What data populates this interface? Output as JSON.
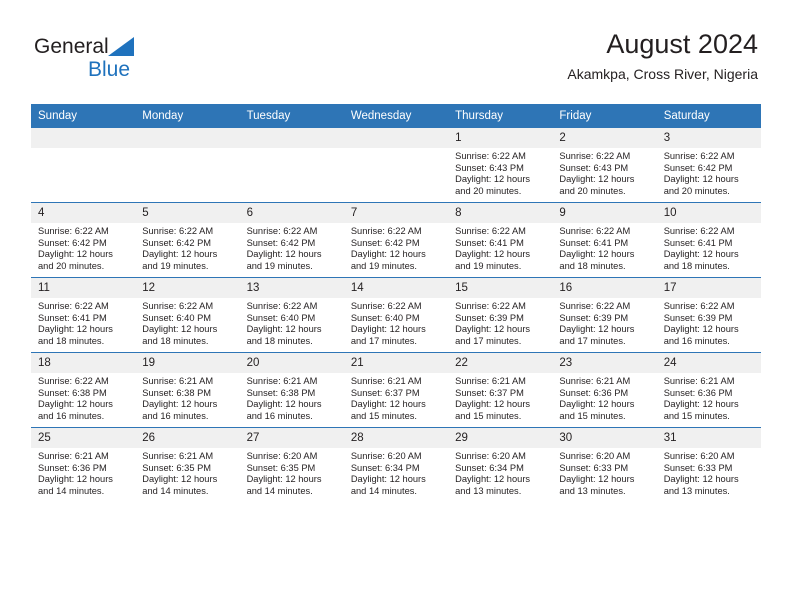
{
  "brand": {
    "name_part1": "General",
    "name_part2": "Blue",
    "accent_color": "#1f72bd",
    "triangle_icon": "brand-triangle-icon"
  },
  "header": {
    "title": "August 2024",
    "location": "Akamkpa, Cross River, Nigeria"
  },
  "calendar": {
    "header_color": "#2e75b6",
    "daynum_band_color": "#f0f0f0",
    "weekday_headers": [
      "Sunday",
      "Monday",
      "Tuesday",
      "Wednesday",
      "Thursday",
      "Friday",
      "Saturday"
    ],
    "weeks": [
      [
        {
          "day": "",
          "sunrise": "",
          "sunset": "",
          "daylight_line1": "",
          "daylight_line2": ""
        },
        {
          "day": "",
          "sunrise": "",
          "sunset": "",
          "daylight_line1": "",
          "daylight_line2": ""
        },
        {
          "day": "",
          "sunrise": "",
          "sunset": "",
          "daylight_line1": "",
          "daylight_line2": ""
        },
        {
          "day": "",
          "sunrise": "",
          "sunset": "",
          "daylight_line1": "",
          "daylight_line2": ""
        },
        {
          "day": "1",
          "sunrise": "Sunrise: 6:22 AM",
          "sunset": "Sunset: 6:43 PM",
          "daylight_line1": "Daylight: 12 hours",
          "daylight_line2": "and 20 minutes."
        },
        {
          "day": "2",
          "sunrise": "Sunrise: 6:22 AM",
          "sunset": "Sunset: 6:43 PM",
          "daylight_line1": "Daylight: 12 hours",
          "daylight_line2": "and 20 minutes."
        },
        {
          "day": "3",
          "sunrise": "Sunrise: 6:22 AM",
          "sunset": "Sunset: 6:42 PM",
          "daylight_line1": "Daylight: 12 hours",
          "daylight_line2": "and 20 minutes."
        }
      ],
      [
        {
          "day": "4",
          "sunrise": "Sunrise: 6:22 AM",
          "sunset": "Sunset: 6:42 PM",
          "daylight_line1": "Daylight: 12 hours",
          "daylight_line2": "and 20 minutes."
        },
        {
          "day": "5",
          "sunrise": "Sunrise: 6:22 AM",
          "sunset": "Sunset: 6:42 PM",
          "daylight_line1": "Daylight: 12 hours",
          "daylight_line2": "and 19 minutes."
        },
        {
          "day": "6",
          "sunrise": "Sunrise: 6:22 AM",
          "sunset": "Sunset: 6:42 PM",
          "daylight_line1": "Daylight: 12 hours",
          "daylight_line2": "and 19 minutes."
        },
        {
          "day": "7",
          "sunrise": "Sunrise: 6:22 AM",
          "sunset": "Sunset: 6:42 PM",
          "daylight_line1": "Daylight: 12 hours",
          "daylight_line2": "and 19 minutes."
        },
        {
          "day": "8",
          "sunrise": "Sunrise: 6:22 AM",
          "sunset": "Sunset: 6:41 PM",
          "daylight_line1": "Daylight: 12 hours",
          "daylight_line2": "and 19 minutes."
        },
        {
          "day": "9",
          "sunrise": "Sunrise: 6:22 AM",
          "sunset": "Sunset: 6:41 PM",
          "daylight_line1": "Daylight: 12 hours",
          "daylight_line2": "and 18 minutes."
        },
        {
          "day": "10",
          "sunrise": "Sunrise: 6:22 AM",
          "sunset": "Sunset: 6:41 PM",
          "daylight_line1": "Daylight: 12 hours",
          "daylight_line2": "and 18 minutes."
        }
      ],
      [
        {
          "day": "11",
          "sunrise": "Sunrise: 6:22 AM",
          "sunset": "Sunset: 6:41 PM",
          "daylight_line1": "Daylight: 12 hours",
          "daylight_line2": "and 18 minutes."
        },
        {
          "day": "12",
          "sunrise": "Sunrise: 6:22 AM",
          "sunset": "Sunset: 6:40 PM",
          "daylight_line1": "Daylight: 12 hours",
          "daylight_line2": "and 18 minutes."
        },
        {
          "day": "13",
          "sunrise": "Sunrise: 6:22 AM",
          "sunset": "Sunset: 6:40 PM",
          "daylight_line1": "Daylight: 12 hours",
          "daylight_line2": "and 18 minutes."
        },
        {
          "day": "14",
          "sunrise": "Sunrise: 6:22 AM",
          "sunset": "Sunset: 6:40 PM",
          "daylight_line1": "Daylight: 12 hours",
          "daylight_line2": "and 17 minutes."
        },
        {
          "day": "15",
          "sunrise": "Sunrise: 6:22 AM",
          "sunset": "Sunset: 6:39 PM",
          "daylight_line1": "Daylight: 12 hours",
          "daylight_line2": "and 17 minutes."
        },
        {
          "day": "16",
          "sunrise": "Sunrise: 6:22 AM",
          "sunset": "Sunset: 6:39 PM",
          "daylight_line1": "Daylight: 12 hours",
          "daylight_line2": "and 17 minutes."
        },
        {
          "day": "17",
          "sunrise": "Sunrise: 6:22 AM",
          "sunset": "Sunset: 6:39 PM",
          "daylight_line1": "Daylight: 12 hours",
          "daylight_line2": "and 16 minutes."
        }
      ],
      [
        {
          "day": "18",
          "sunrise": "Sunrise: 6:22 AM",
          "sunset": "Sunset: 6:38 PM",
          "daylight_line1": "Daylight: 12 hours",
          "daylight_line2": "and 16 minutes."
        },
        {
          "day": "19",
          "sunrise": "Sunrise: 6:21 AM",
          "sunset": "Sunset: 6:38 PM",
          "daylight_line1": "Daylight: 12 hours",
          "daylight_line2": "and 16 minutes."
        },
        {
          "day": "20",
          "sunrise": "Sunrise: 6:21 AM",
          "sunset": "Sunset: 6:38 PM",
          "daylight_line1": "Daylight: 12 hours",
          "daylight_line2": "and 16 minutes."
        },
        {
          "day": "21",
          "sunrise": "Sunrise: 6:21 AM",
          "sunset": "Sunset: 6:37 PM",
          "daylight_line1": "Daylight: 12 hours",
          "daylight_line2": "and 15 minutes."
        },
        {
          "day": "22",
          "sunrise": "Sunrise: 6:21 AM",
          "sunset": "Sunset: 6:37 PM",
          "daylight_line1": "Daylight: 12 hours",
          "daylight_line2": "and 15 minutes."
        },
        {
          "day": "23",
          "sunrise": "Sunrise: 6:21 AM",
          "sunset": "Sunset: 6:36 PM",
          "daylight_line1": "Daylight: 12 hours",
          "daylight_line2": "and 15 minutes."
        },
        {
          "day": "24",
          "sunrise": "Sunrise: 6:21 AM",
          "sunset": "Sunset: 6:36 PM",
          "daylight_line1": "Daylight: 12 hours",
          "daylight_line2": "and 15 minutes."
        }
      ],
      [
        {
          "day": "25",
          "sunrise": "Sunrise: 6:21 AM",
          "sunset": "Sunset: 6:36 PM",
          "daylight_line1": "Daylight: 12 hours",
          "daylight_line2": "and 14 minutes."
        },
        {
          "day": "26",
          "sunrise": "Sunrise: 6:21 AM",
          "sunset": "Sunset: 6:35 PM",
          "daylight_line1": "Daylight: 12 hours",
          "daylight_line2": "and 14 minutes."
        },
        {
          "day": "27",
          "sunrise": "Sunrise: 6:20 AM",
          "sunset": "Sunset: 6:35 PM",
          "daylight_line1": "Daylight: 12 hours",
          "daylight_line2": "and 14 minutes."
        },
        {
          "day": "28",
          "sunrise": "Sunrise: 6:20 AM",
          "sunset": "Sunset: 6:34 PM",
          "daylight_line1": "Daylight: 12 hours",
          "daylight_line2": "and 14 minutes."
        },
        {
          "day": "29",
          "sunrise": "Sunrise: 6:20 AM",
          "sunset": "Sunset: 6:34 PM",
          "daylight_line1": "Daylight: 12 hours",
          "daylight_line2": "and 13 minutes."
        },
        {
          "day": "30",
          "sunrise": "Sunrise: 6:20 AM",
          "sunset": "Sunset: 6:33 PM",
          "daylight_line1": "Daylight: 12 hours",
          "daylight_line2": "and 13 minutes."
        },
        {
          "day": "31",
          "sunrise": "Sunrise: 6:20 AM",
          "sunset": "Sunset: 6:33 PM",
          "daylight_line1": "Daylight: 12 hours",
          "daylight_line2": "and 13 minutes."
        }
      ]
    ]
  }
}
